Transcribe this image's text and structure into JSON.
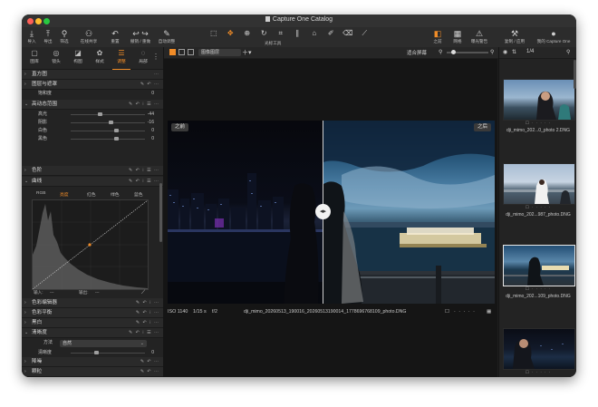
{
  "app": {
    "window_title": "Capture One Catalog"
  },
  "toolbar": {
    "left_buttons": [
      {
        "label": "导入",
        "icon": "import-icon"
      },
      {
        "label": "导出",
        "icon": "export-icon"
      },
      {
        "label": "筛选",
        "icon": "filter-icon"
      },
      {
        "label": "在线共享",
        "icon": "share-icon"
      },
      {
        "label": "重置",
        "icon": "reset-icon"
      },
      {
        "label": "撤销 / 重做",
        "icon": "undo-redo-icon"
      },
      {
        "label": "自动调整",
        "icon": "auto-adjust-icon"
      }
    ],
    "cursor_tools_label": "光标工具",
    "right_buttons": [
      {
        "label": "之前",
        "icon": "before-icon"
      },
      {
        "label": "网格",
        "icon": "grid-icon"
      },
      {
        "label": "曝光警告",
        "icon": "exposure-warning-icon"
      },
      {
        "label": "复制 / 应用",
        "icon": "copy-apply-icon"
      },
      {
        "label": "我的 Capture One",
        "icon": "account-icon"
      }
    ]
  },
  "subbar": {
    "zoom_mode": "图像图层",
    "fit_label": "适合屏幕",
    "page_counter": "1/4"
  },
  "tool_tabs": [
    {
      "label": "图库",
      "icon": "library-icon"
    },
    {
      "label": "镜头",
      "icon": "lens-icon"
    },
    {
      "label": "构图",
      "icon": "composition-icon"
    },
    {
      "label": "样式",
      "icon": "styles-icon"
    },
    {
      "label": "调整",
      "icon": "adjust-icon",
      "active": true
    },
    {
      "label": "局部",
      "icon": "local-icon"
    }
  ],
  "sections": {
    "histogram": "直方图",
    "layers": "图层与遮罩",
    "saturation_row": {
      "label": "饱和度",
      "value": "0"
    },
    "hdr": "高动态范围",
    "hdr_rows": [
      {
        "label": "高光",
        "value": "-44"
      },
      {
        "label": "阴影",
        "value": "-16"
      },
      {
        "label": "白色",
        "value": "0"
      },
      {
        "label": "黑色",
        "value": "0"
      }
    ],
    "levels": "色阶",
    "curve": "曲线",
    "curve_tabs": [
      "RGB",
      "亮度",
      "红色",
      "绿色",
      "蓝色"
    ],
    "curve_input": "输入:",
    "curve_output": "输出:",
    "curve_dash": "---",
    "color_editor": "色彩编辑器",
    "color_balance": "色彩平衡",
    "bw": "黑白",
    "clarity": "清晰度",
    "clarity_method_label": "方法",
    "clarity_method": "自然",
    "clarity_rows": [
      {
        "label": "清晰度",
        "value": "0"
      },
      {
        "label": "结构",
        "value": "0"
      }
    ],
    "denoise": "降噪",
    "grain": "颗粒"
  },
  "viewer": {
    "before_label": "之前",
    "after_label": "之后",
    "iso": "ISO 1140",
    "shutter": "1/15 s",
    "aperture": "f/2",
    "filename": "dji_mimo_20260513_190016_20260513190014_1778696768109_photo.DNG"
  },
  "filmstrip": [
    {
      "name": "dji_mimo_202...0_photo 2.DNG",
      "selected": false
    },
    {
      "name": "dji_mimo_202...987_photo.DNG",
      "selected": false
    },
    {
      "name": "dji_mimo_202...109_photo.DNG",
      "selected": true
    },
    {
      "name": "",
      "selected": false
    }
  ],
  "colors": {
    "accent": "#f08c28",
    "panel": "#232323",
    "viewer_bg": "#151515"
  }
}
